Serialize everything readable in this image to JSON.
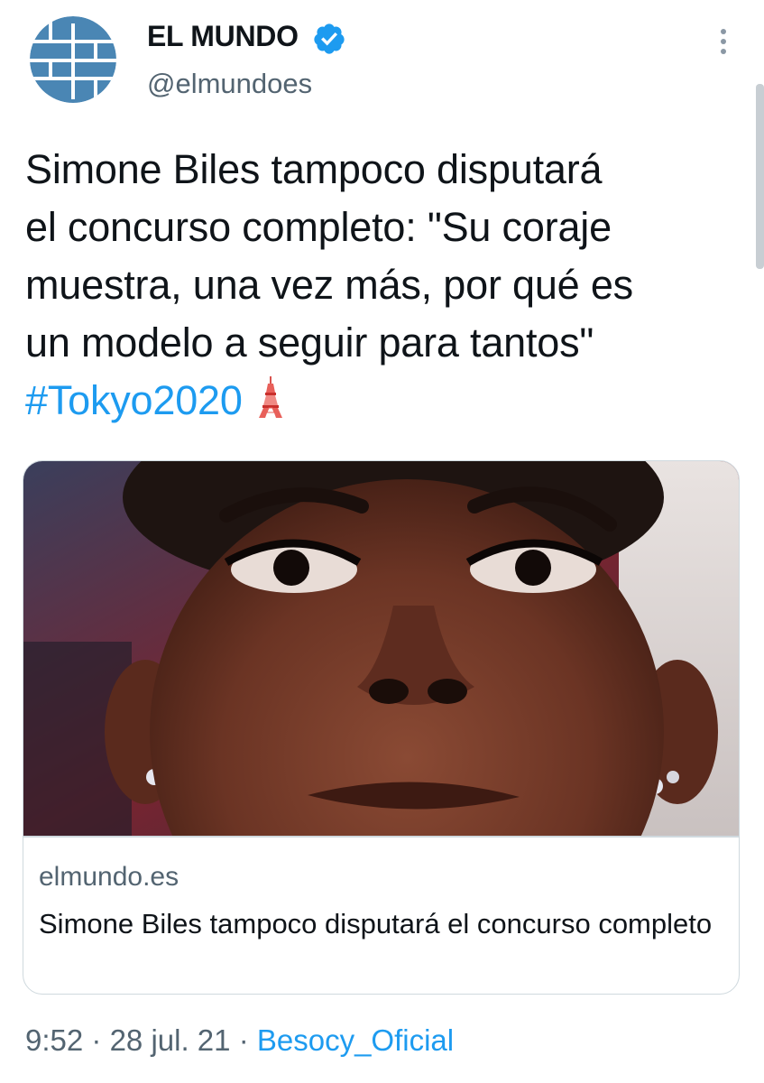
{
  "author": {
    "name": "EL MUNDO",
    "handle": "@elmundoes",
    "avatar_icon": "el-mundo-logo-icon",
    "verified_icon": "verified-badge-icon"
  },
  "tweet": {
    "text_lines": [
      "Simone Biles tampoco disputará",
      "el concurso completo: \"Su coraje",
      "muestra, una vez más, por qué es",
      "un modelo a seguir para tantos\""
    ],
    "hashtag": "#Tokyo2020",
    "emoji_icon": "tokyo-tower-icon"
  },
  "card": {
    "image_icon": "athlete-face-photo",
    "domain": "elmundo.es",
    "title": "Simone Biles tampoco disputará el concurso completo"
  },
  "meta": {
    "time": "9:52",
    "separator": "·",
    "date": "28 jul. 21",
    "source": "Besocy_Oficial"
  },
  "colors": {
    "link": "#1d9bf0",
    "secondary_text": "#536471",
    "logo_blue": "#4a86b4",
    "border": "#cfd9de"
  }
}
